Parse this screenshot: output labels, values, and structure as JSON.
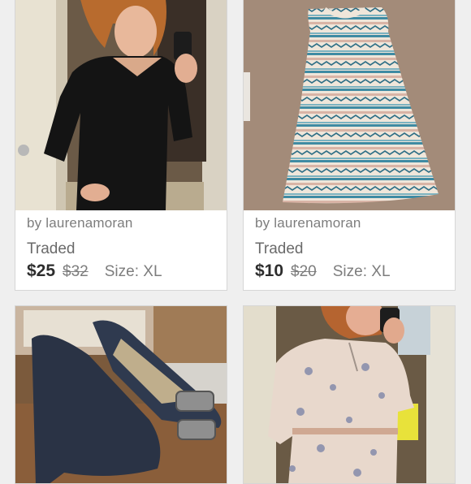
{
  "listings": [
    {
      "seller": "by laurenamoran",
      "status": "Traded",
      "price": "$25",
      "original_price": "$32",
      "size": "Size: XL",
      "photo_subject": "black-button-shirt-selfie"
    },
    {
      "seller": "by laurenamoran",
      "status": "Traded",
      "price": "$10",
      "original_price": "$20",
      "size": "Size: XL",
      "photo_subject": "tribal-print-maxi-skirt"
    },
    {
      "photo_subject": "navy-wedge-heels"
    },
    {
      "photo_subject": "floral-blouse-selfie"
    }
  ],
  "colors": {
    "background": "#efefef",
    "card": "#ffffff",
    "price": "#2d2d2d",
    "muted_text": "#7d7d7d"
  }
}
